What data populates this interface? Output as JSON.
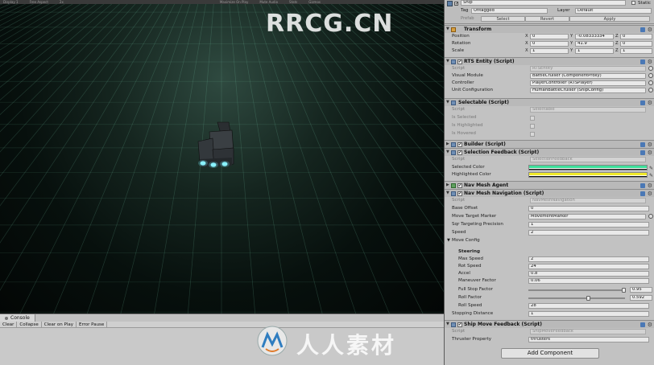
{
  "scene": {
    "toolbar": [
      "Display 1",
      "Free Aspect",
      "2x",
      "Maximize On Play",
      "Mute Audio",
      "Stats",
      "Gizmos"
    ],
    "watermark": "RRCG.CN"
  },
  "console": {
    "tab_label": "Console",
    "buttons": [
      "Clear",
      "Collapse",
      "Clear on Play",
      "Error Pause"
    ],
    "watermark_text": "人人素材"
  },
  "inspector": {
    "object_name": "Ship",
    "static_label": "Static",
    "tag_label": "Tag",
    "tag_value": "Untagged",
    "layer_label": "Layer",
    "layer_value": "Default",
    "prefab_label": "Prefab",
    "prefab_buttons": [
      "Select",
      "Revert",
      "Apply"
    ],
    "transform": {
      "title": "Transform",
      "rows": [
        {
          "label": "Position",
          "x": "0",
          "y": "-0.08333334",
          "z": "0"
        },
        {
          "label": "Rotation",
          "x": "0",
          "y": "41.9",
          "z": "0"
        },
        {
          "label": "Scale",
          "x": "1",
          "y": "1",
          "z": "1"
        }
      ]
    },
    "rts_entity": {
      "title": "RTS Entity (Script)",
      "rows": [
        {
          "label": "Script",
          "value": "RTSEntity"
        },
        {
          "label": "Visual Module",
          "value": "BattleCruiser (ComponentProxy)"
        },
        {
          "label": "Controller",
          "value": "PlayerController (RTSPlayer)"
        },
        {
          "label": "Unit Configuration",
          "value": "HumanBattleCruiser (ShipConfig)"
        }
      ]
    },
    "selectable": {
      "title": "Selectable (Script)",
      "script_label": "Script",
      "script_value": "Selectable",
      "flags": [
        "Is Selected",
        "Is Highlighted",
        "Is Hovered"
      ]
    },
    "builder": {
      "title": "Builder (Script)"
    },
    "selection_feedback": {
      "title": "Selection Feedback (Script)",
      "script_label": "Script",
      "script_value": "SelectionFeedback",
      "selected_label": "Selected Color",
      "selected_color": "#3ddf9a",
      "highlighted_label": "Highlighted Color",
      "highlighted_color": "#f2ea2a"
    },
    "nav_agent": {
      "title": "Nav Mesh Agent"
    },
    "nav_navigation": {
      "title": "Nav Mesh Navigation (Script)",
      "script_label": "Script",
      "script_value": "NavMeshNavigation",
      "base_offset_label": "Base Offset",
      "base_offset": "0",
      "move_target_label": "Move Target Marker",
      "move_target": "MovementMarker",
      "sqr_label": "Sqr Targeting Precision",
      "sqr": "1",
      "speed_label": "Speed",
      "speed": "2",
      "move_config_label": "Move Config",
      "steering_label": "Steering",
      "steering": [
        {
          "label": "Max Speed",
          "value": "2"
        },
        {
          "label": "Rot Speed",
          "value": "24"
        },
        {
          "label": "Accel",
          "value": "0.8"
        },
        {
          "label": "Maneuver Factor",
          "value": "0.06"
        }
      ],
      "full_stop_label": "Full Stop Factor",
      "full_stop": "0.95",
      "roll_factor_label": "Roll Factor",
      "roll_factor": "0.592",
      "roll_speed_label": "Roll Speed",
      "roll_speed": "28",
      "stopping_label": "Stopping Distance",
      "stopping": "1"
    },
    "ship_move": {
      "title": "Ship Move Feedback (Script)",
      "script_label": "Script",
      "script_value": "ShipMoveFeedback",
      "thruster_label": "Thruster Property",
      "thruster_value": "thrusters"
    },
    "add_component": "Add Component"
  }
}
